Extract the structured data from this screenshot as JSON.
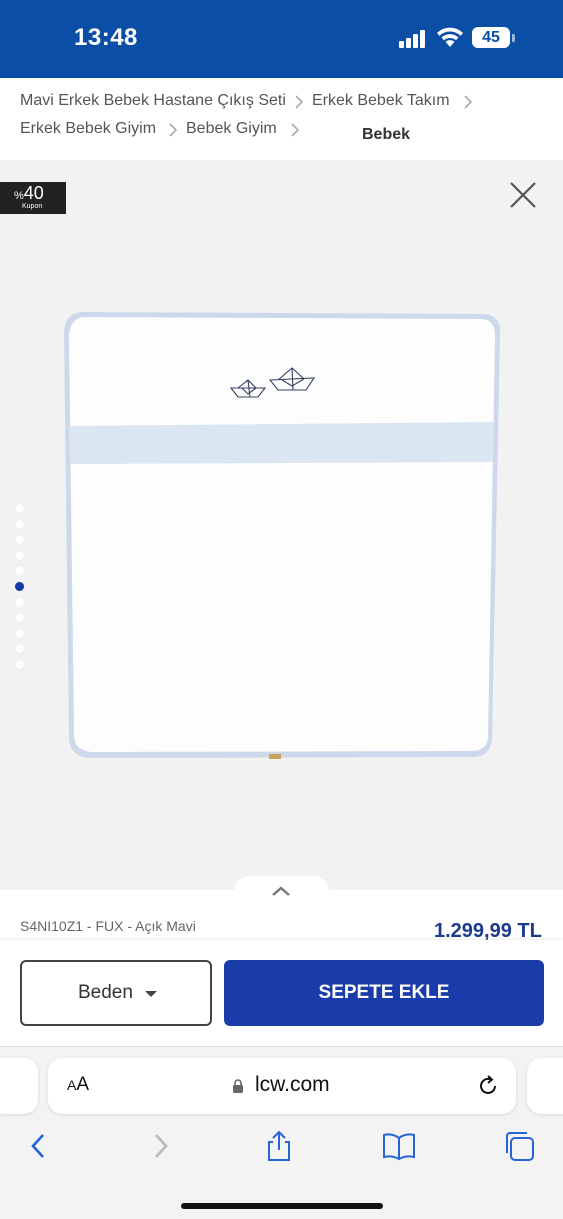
{
  "status_bar": {
    "time": "13:48",
    "battery": "45",
    "bg_color": "#0a4ea6"
  },
  "breadcrumb": {
    "items": [
      "Mavi Erkek Bebek Hastane Çıkış Seti",
      "Erkek Bebek Takım",
      "Erkek Bebek Giyim",
      "Bebek Giyim"
    ],
    "current": "Bebek"
  },
  "gallery": {
    "coupon": {
      "percent_sign": "%",
      "percent": "40",
      "label": "Kupon"
    },
    "dots_total": 11,
    "active_dot": 6,
    "icons": [
      "close-icon",
      "chevron-up-icon"
    ]
  },
  "product": {
    "sku": "S4NI10Z1 - FUX - Açık Mavi",
    "price": "1.299,99 TL"
  },
  "actions": {
    "size_label": "Beden",
    "add_to_cart_label": "SEPETE EKLE",
    "accent_color": "#1a3caa"
  },
  "browser": {
    "aa_small": "A",
    "aa_large": "A",
    "url": "lcw.com",
    "toolbar_icons": [
      "back-icon",
      "forward-icon",
      "share-icon",
      "bookmarks-icon",
      "tabs-icon"
    ]
  }
}
